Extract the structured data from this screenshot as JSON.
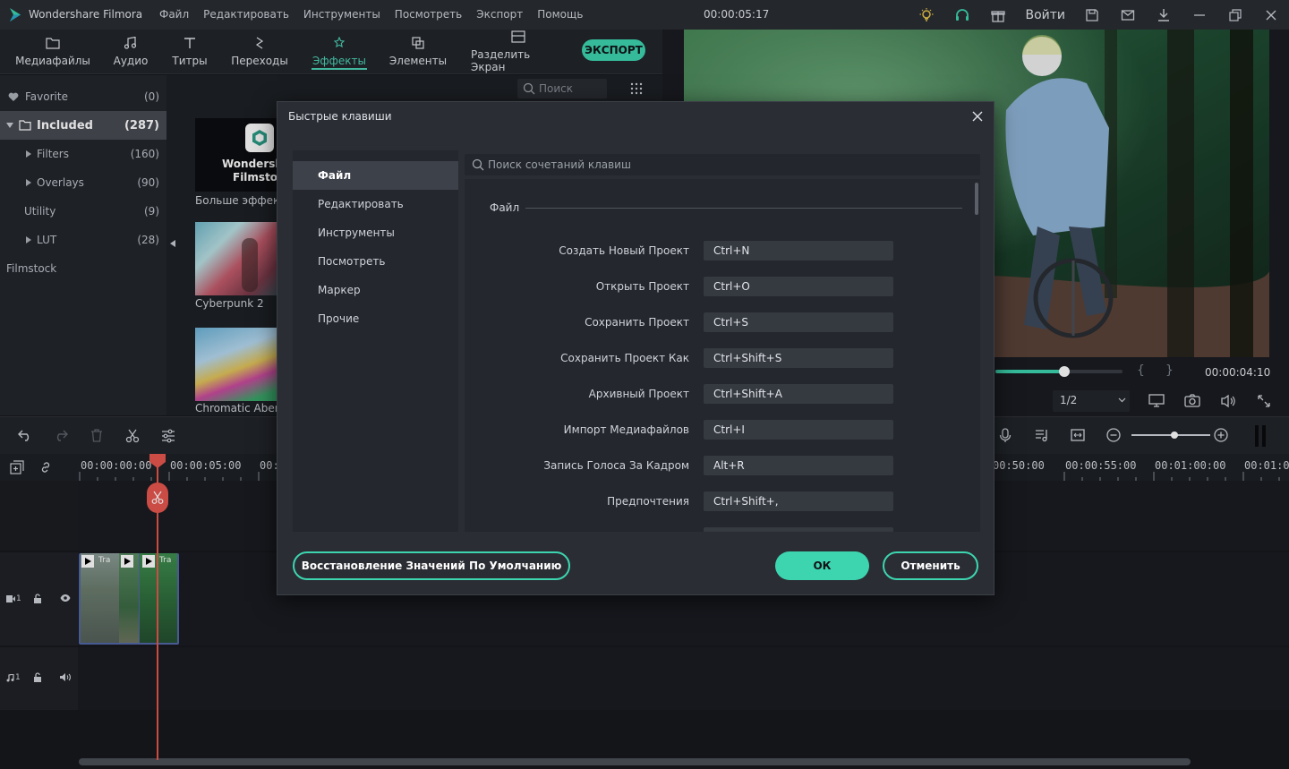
{
  "app": {
    "name": "Wondershare Filmora",
    "menu": [
      "Файл",
      "Редактировать",
      "Инструменты",
      "Посмотреть",
      "Экспорт",
      "Помощь"
    ],
    "timecode": "00:00:05:17",
    "login": "Войти"
  },
  "toolbar": {
    "tabs": [
      {
        "label": "Медиафайлы",
        "icon": "folder-icon"
      },
      {
        "label": "Аудио",
        "icon": "music-note-icon"
      },
      {
        "label": "Титры",
        "icon": "text-icon"
      },
      {
        "label": "Переходы",
        "icon": "transition-icon"
      },
      {
        "label": "Эффекты",
        "icon": "effects-icon"
      },
      {
        "label": "Элементы",
        "icon": "elements-icon"
      },
      {
        "label": "Разделить Экран",
        "icon": "split-screen-icon"
      }
    ],
    "export_label": "ЭКСПОРТ"
  },
  "library": {
    "items": [
      {
        "label": "Favorite",
        "count": "(0)"
      },
      {
        "label": "Included",
        "count": "(287)"
      },
      {
        "label": "Filters",
        "count": "(160)"
      },
      {
        "label": "Overlays",
        "count": "(90)"
      },
      {
        "label": "Utility",
        "count": "(9)"
      },
      {
        "label": "LUT",
        "count": "(28)"
      },
      {
        "label": "Filmstock",
        "count": ""
      }
    ]
  },
  "effects": {
    "search_placeholder": "Поиск",
    "items": [
      {
        "label": "Больше эффект",
        "logo_line1": "Wondersh",
        "logo_line2": "Filmsto"
      },
      {
        "label": "Cyberpunk 2"
      },
      {
        "label": "Chromatic Aberra"
      }
    ]
  },
  "preview": {
    "time": "00:00:04:10",
    "ratio": "1/2",
    "progress": 0.54
  },
  "timeline": {
    "ruler": [
      "00:00:00:00",
      "00:00:05:00",
      "00:",
      "00:50:00",
      "00:00:55:00",
      "00:01:00:00",
      "00:01:0"
    ],
    "clip_label": "Tra",
    "video_track": "1",
    "audio_track": "1"
  },
  "dialog": {
    "title": "Быстрые клавиши",
    "categories": [
      "Файл",
      "Редактировать",
      "Инструменты",
      "Посмотреть",
      "Маркер",
      "Прочие"
    ],
    "search_placeholder": "Поиск сочетаний клавиш",
    "section": "Файл",
    "shortcuts": [
      {
        "name": "Создать Новый Проект",
        "key": "Ctrl+N"
      },
      {
        "name": "Открыть Проект",
        "key": "Ctrl+O"
      },
      {
        "name": "Сохранить Проект",
        "key": "Ctrl+S"
      },
      {
        "name": "Сохранить Проект Как",
        "key": "Ctrl+Shift+S"
      },
      {
        "name": "Архивный Проект",
        "key": "Ctrl+Shift+A"
      },
      {
        "name": "Импорт Медиафайлов",
        "key": "Ctrl+I"
      },
      {
        "name": "Запись Голоса За Кадром",
        "key": "Alt+R"
      },
      {
        "name": "Предпочтения",
        "key": "Ctrl+Shift+,"
      }
    ],
    "restore_label": "Восстановление Значений По Умолчанию",
    "ok_label": "ОК",
    "cancel_label": "Отменить"
  },
  "colors": {
    "accent": "#3dd5b0",
    "playhead": "#e8574f"
  }
}
